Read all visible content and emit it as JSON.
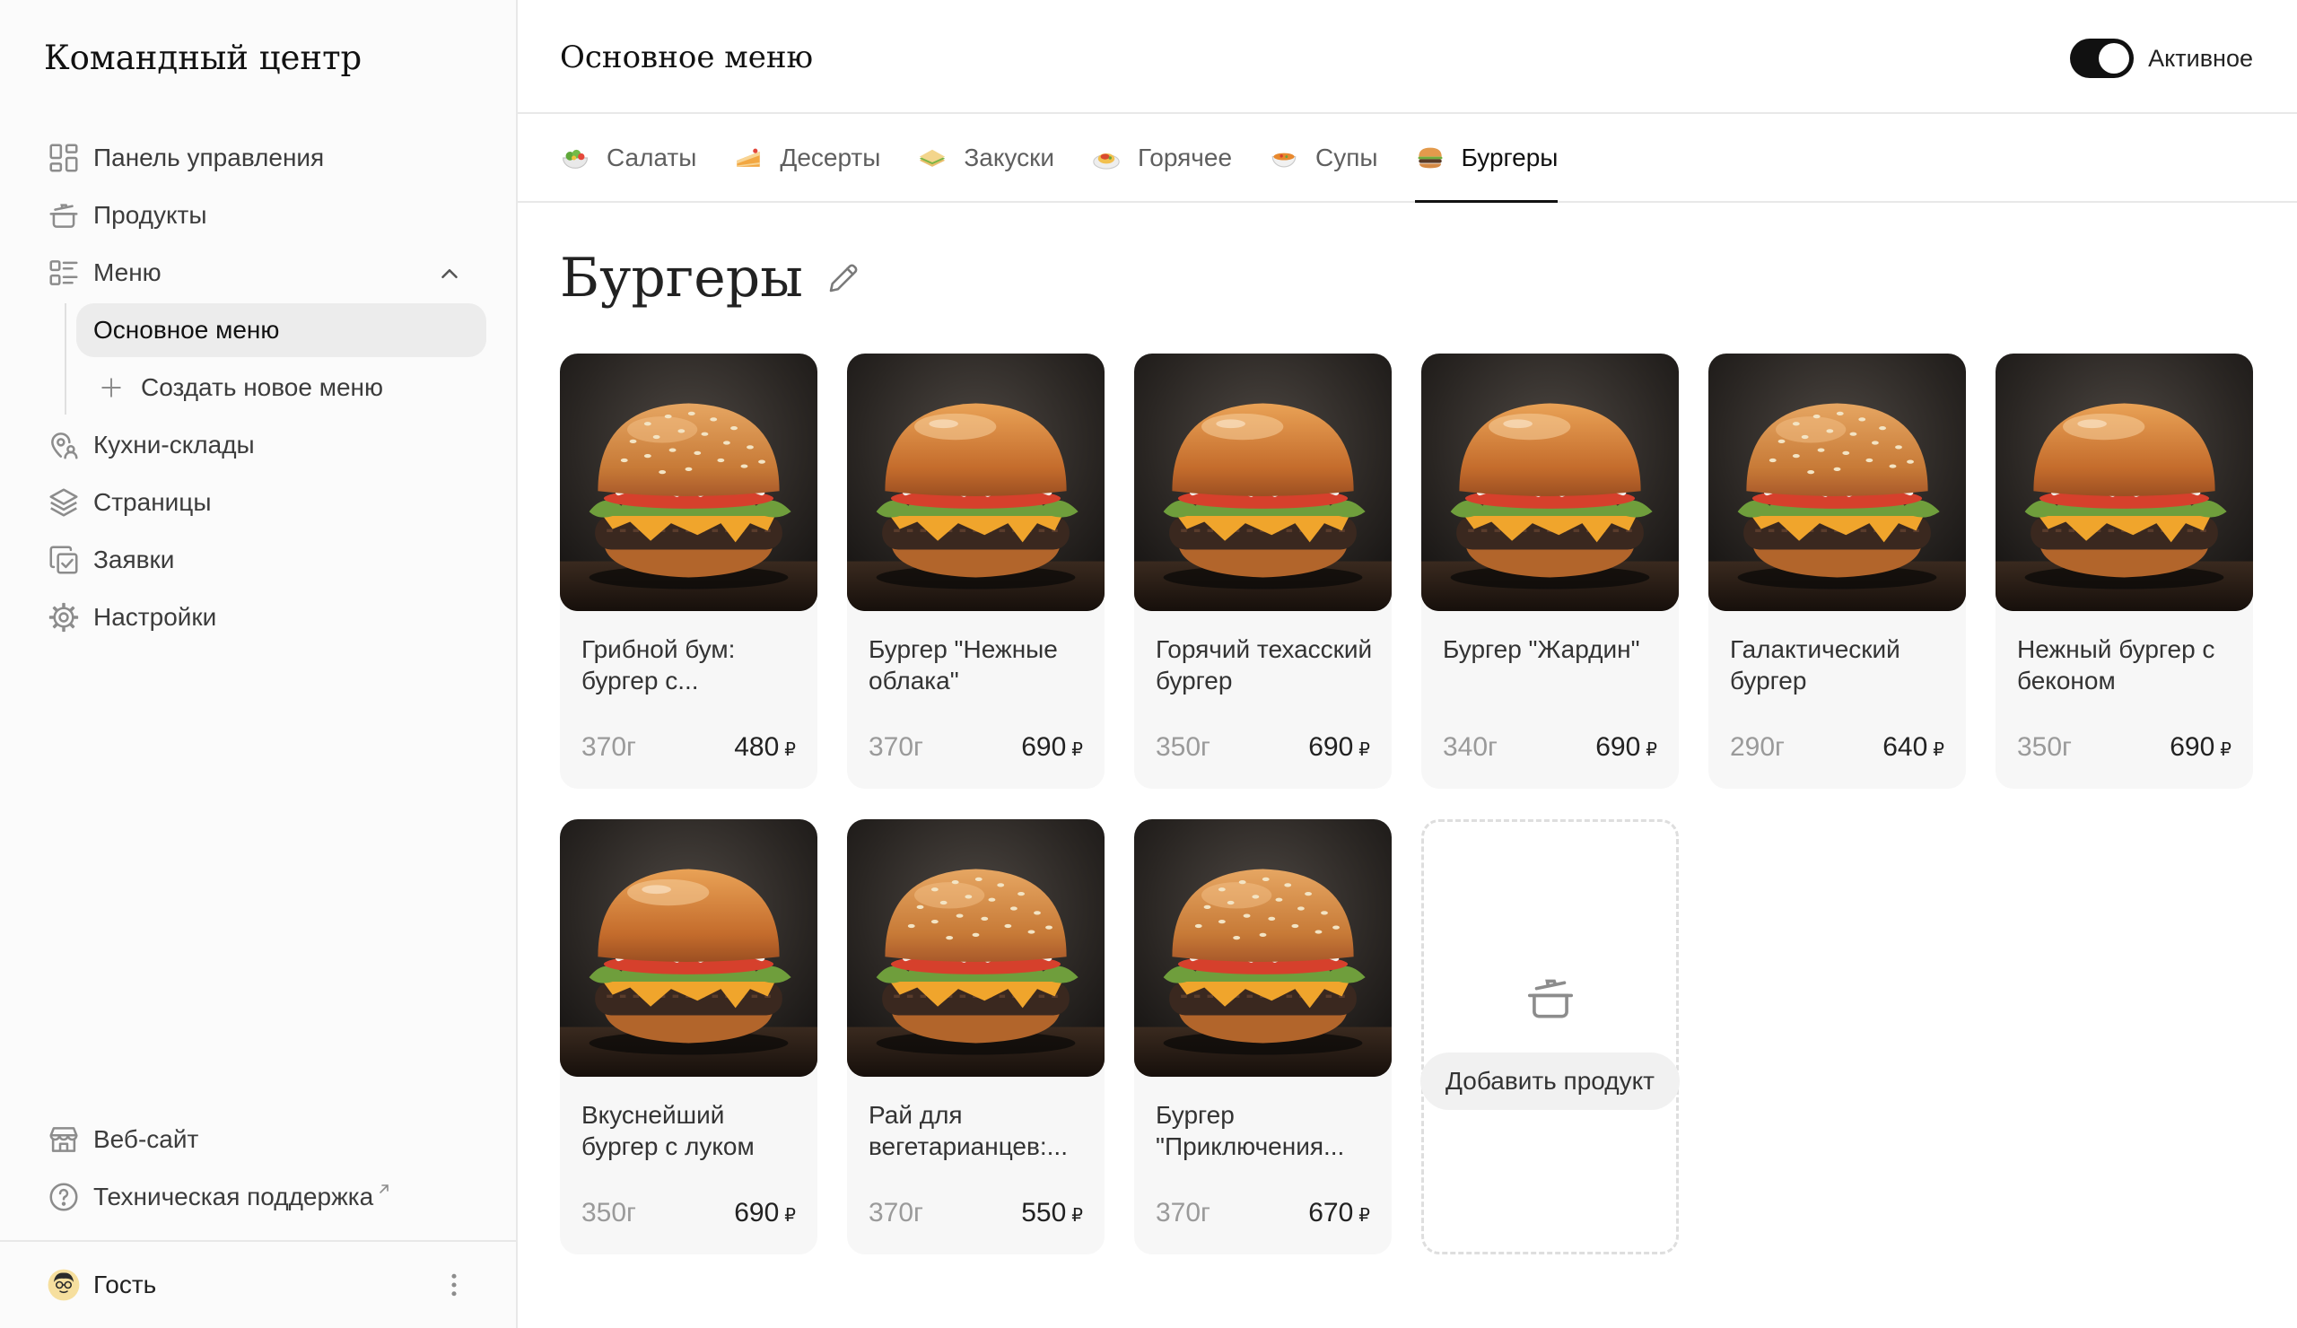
{
  "sidebar": {
    "title": "Командный центр",
    "nav": [
      {
        "label": "Панель управления",
        "icon": "dashboard-icon"
      },
      {
        "label": "Продукты",
        "icon": "pot-icon"
      },
      {
        "label": "Меню",
        "icon": "menu-list-icon",
        "expanded": true,
        "children": [
          {
            "label": "Основное меню",
            "selected": true
          },
          {
            "label": "Создать новое меню",
            "icon": "plus-icon"
          }
        ]
      },
      {
        "label": "Кухни-склады",
        "icon": "location-pin-icon"
      },
      {
        "label": "Страницы",
        "icon": "layers-icon"
      },
      {
        "label": "Заявки",
        "icon": "orders-icon"
      },
      {
        "label": "Настройки",
        "icon": "gear-icon"
      }
    ],
    "footer_links": [
      {
        "label": "Веб-сайт",
        "icon": "store-icon"
      },
      {
        "label": "Техническая поддержка",
        "icon": "help-icon",
        "external": true
      }
    ],
    "user": {
      "name": "Гость",
      "icon": "avatar"
    }
  },
  "header": {
    "title": "Основное меню",
    "status_toggle": {
      "label": "Активное",
      "on": true
    }
  },
  "tabs": [
    {
      "label": "Салаты",
      "icon": "salad-icon"
    },
    {
      "label": "Десерты",
      "icon": "dessert-icon"
    },
    {
      "label": "Закуски",
      "icon": "sandwich-icon"
    },
    {
      "label": "Горячее",
      "icon": "hot-dish-icon"
    },
    {
      "label": "Супы",
      "icon": "soup-icon"
    },
    {
      "label": "Бургеры",
      "icon": "burger-icon",
      "active": true
    }
  ],
  "section": {
    "title": "Бургеры"
  },
  "currency": "₽",
  "products": [
    {
      "name": "Грибной бум: бургер с...",
      "weight": "370г",
      "price": "480"
    },
    {
      "name": "Бургер \"Нежные облака\"",
      "weight": "370г",
      "price": "690"
    },
    {
      "name": "Горячий техасский бургер",
      "weight": "350г",
      "price": "690"
    },
    {
      "name": "Бургер \"Жардин\"",
      "weight": "340г",
      "price": "690"
    },
    {
      "name": "Галактический бургер",
      "weight": "290г",
      "price": "640"
    },
    {
      "name": "Нежный бургер с беконом",
      "weight": "350г",
      "price": "690"
    },
    {
      "name": "Вкуснейший бургер с луком",
      "weight": "350г",
      "price": "690"
    },
    {
      "name": "Рай для вегетарианцев:...",
      "weight": "370г",
      "price": "550"
    },
    {
      "name": "Бургер \"Приключения...",
      "weight": "370г",
      "price": "670"
    }
  ],
  "add_product": {
    "label": "Добавить продукт",
    "icon": "pot-icon"
  },
  "colors": {
    "accent": "#111111",
    "card_background": "#f7f7f7",
    "selected_nav_background": "#ececec",
    "muted_text": "#9a9a9a"
  }
}
